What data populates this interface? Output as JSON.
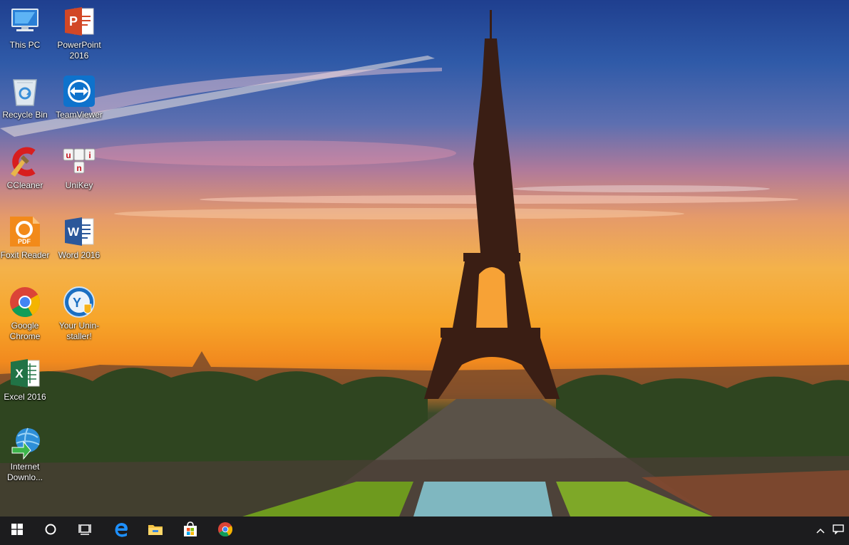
{
  "desktop": {
    "icons": [
      {
        "label": "This PC",
        "icon": "computer-icon"
      },
      {
        "label": "PowerPoint 2016",
        "icon": "powerpoint-icon"
      },
      {
        "label": "Recycle Bin",
        "icon": "recycle-bin-icon"
      },
      {
        "label": "TeamViewer",
        "icon": "teamviewer-icon"
      },
      {
        "label": "CCleaner",
        "icon": "ccleaner-icon"
      },
      {
        "label": "UniKey",
        "icon": "unikey-icon"
      },
      {
        "label": "Foxit Reader",
        "icon": "foxit-reader-icon"
      },
      {
        "label": "Word 2016",
        "icon": "word-icon"
      },
      {
        "label": "Google Chrome",
        "icon": "chrome-icon"
      },
      {
        "label": "Your Unin-staller!",
        "icon": "uninstaller-icon"
      },
      {
        "label": "Excel 2016",
        "icon": "excel-icon"
      },
      {
        "label": "Internet Downlo...",
        "icon": "internet-download-manager-icon"
      }
    ],
    "icon_glyphs": {
      "powerpoint": "P",
      "word": "W",
      "excel": "X",
      "foxit": "PDF",
      "unikey_keys": [
        "u",
        "i",
        "n"
      ],
      "uninstaller": "Y"
    }
  },
  "taskbar": {
    "items": [
      {
        "icon": "windows-start-icon"
      },
      {
        "icon": "cortana-search-icon"
      },
      {
        "icon": "task-view-icon"
      },
      {
        "icon": "edge-icon"
      },
      {
        "icon": "file-explorer-icon"
      },
      {
        "icon": "store-icon"
      },
      {
        "icon": "chrome-icon"
      }
    ],
    "tray": [
      {
        "icon": "chevron-up-icon"
      },
      {
        "icon": "notification-icon"
      }
    ],
    "colors": {
      "background": "#1c1c1e",
      "icon": "#ffffff"
    }
  }
}
